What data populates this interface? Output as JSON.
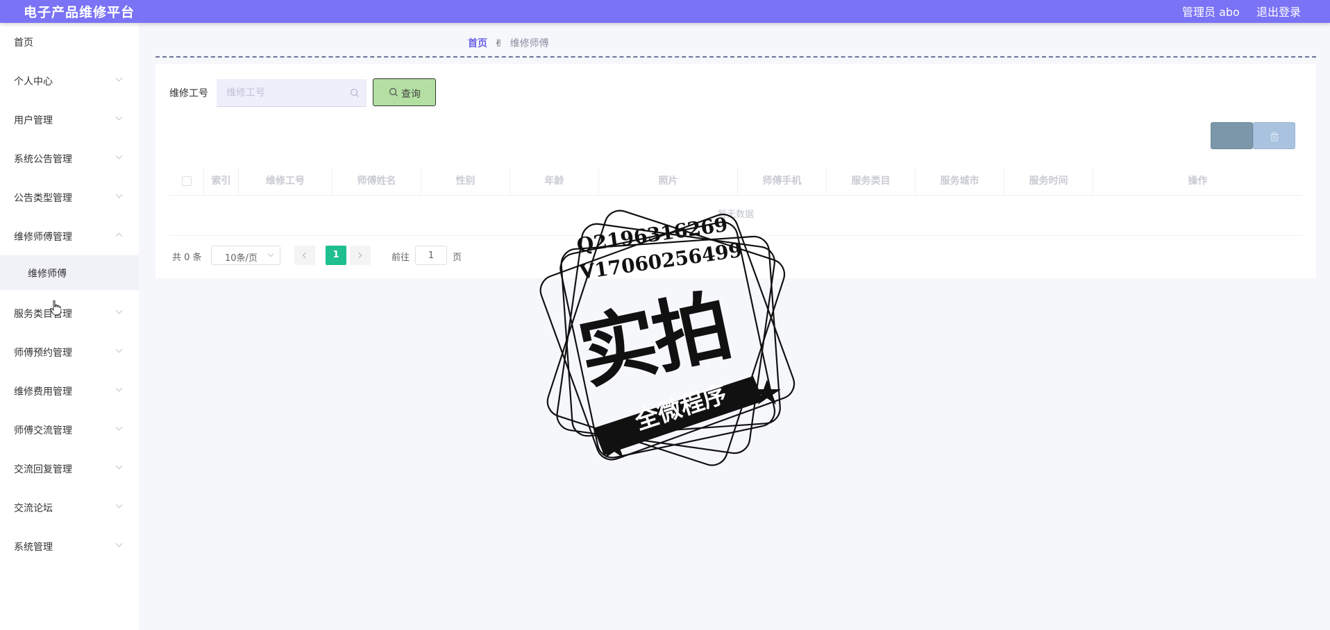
{
  "header": {
    "brand": "电子产品维修平台",
    "user": "管理员 abo",
    "logout": "退出登录"
  },
  "sidebar": {
    "items": [
      {
        "label": "首页"
      },
      {
        "label": "个人中心"
      },
      {
        "label": "用户管理"
      },
      {
        "label": "系统公告管理"
      },
      {
        "label": "公告类型管理"
      },
      {
        "label": "维修师傅管理"
      },
      {
        "label": "服务类目管理"
      },
      {
        "label": "师傅预约管理"
      },
      {
        "label": "维修费用管理"
      },
      {
        "label": "师傅交流管理"
      },
      {
        "label": "交流回复管理"
      },
      {
        "label": "交流论坛"
      },
      {
        "label": "系统管理"
      }
    ],
    "submenu": {
      "label": "维修师傅"
    }
  },
  "breadcrumb": {
    "home": "首页",
    "current": "维修师傅"
  },
  "search": {
    "label": "维修工号",
    "placeholder": "维修工号",
    "button": "查询"
  },
  "table": {
    "columns": [
      "索引",
      "维修工号",
      "师傅姓名",
      "性别",
      "年龄",
      "照片",
      "师傅手机",
      "服务类目",
      "服务城市",
      "服务时间",
      "操作"
    ],
    "empty": "暂无数据"
  },
  "pagination": {
    "total": "共 0 条",
    "page_size": "10条/页",
    "current_page": "1",
    "goto_label": "前往",
    "goto_value": "1",
    "page_suffix": "页"
  },
  "watermark": {
    "line1": "Q2196316269",
    "line2": "V17060256499",
    "main": "实拍",
    "banner": "全微程序"
  },
  "colors": {
    "header": "#7a73f5",
    "query_button": "#b3e0a2",
    "active_page": "#1fbf8f"
  }
}
